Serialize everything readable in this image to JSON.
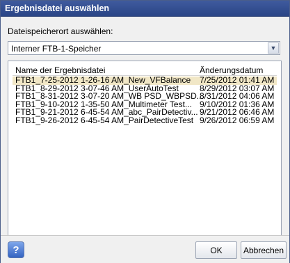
{
  "dialog": {
    "title": "Ergebnisdatei auswählen",
    "location_label": "Dateispeicherort auswählen:",
    "location_value": "Interner FTB-1-Speicher"
  },
  "table": {
    "columns": [
      "Name der Ergebnisdatei",
      "Änderungsdatum"
    ],
    "rows": [
      {
        "name": "FTB1_7-25-2012 1-26-16 AM_New_VFBalance",
        "date": "7/25/2012 01:41 AM"
      },
      {
        "name": "FTB1_8-29-2012 3-07-46 AM_UserAutoTest",
        "date": "8/29/2012 03:07 AM"
      },
      {
        "name": "FTB1_8-31-2012 3-07-20 AM_WB PSD_WBPSD...",
        "date": "8/31/2012 04:06 AM"
      },
      {
        "name": "FTB1_9-10-2012 1-35-50 AM_Multimeter Test...",
        "date": "9/10/2012 01:36 AM"
      },
      {
        "name": "FTB1_9-21-2012 6-45-54 AM_abc_PairDetectiv...",
        "date": "9/21/2012 06:46 AM"
      },
      {
        "name": "FTB1_9-26-2012 6-45-54 AM_PairDetectiveTest",
        "date": "9/26/2012 06:59 AM"
      }
    ],
    "selected_index": 0
  },
  "buttons": {
    "help": "?",
    "ok": "OK",
    "cancel": "Abbrechen"
  },
  "colors": {
    "title_bar": "#2f4b8f",
    "selection": "#f1e7c6"
  }
}
